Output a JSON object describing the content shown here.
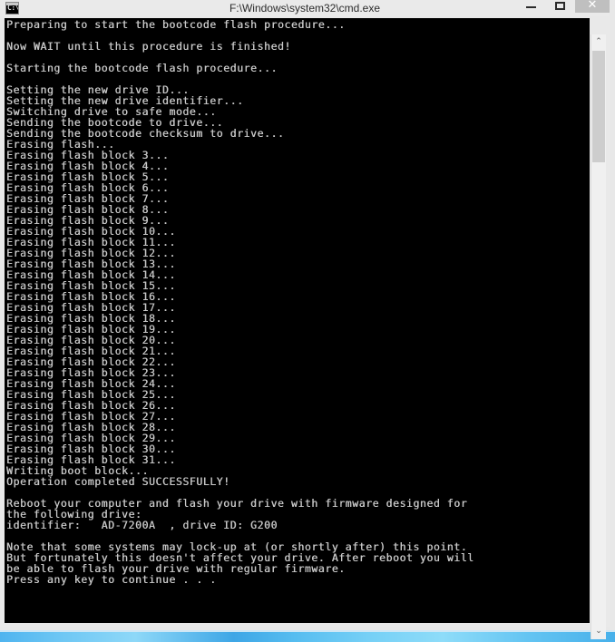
{
  "window": {
    "title": "F:\\Windows\\system32\\cmd.exe",
    "icon_name": "cmd-icon",
    "icon_glyph": "C:\\",
    "controls": {
      "minimize_label": "–",
      "maximize_label": "□",
      "close_label": "✕"
    }
  },
  "scrollbar": {
    "up_arrow": "⌃",
    "down_arrow": "⌄"
  },
  "console": {
    "foreground_color": "#c8c8c8",
    "background_color": "#000000",
    "output": "Preparing to start the bootcode flash procedure...\n\nNow WAIT until this procedure is finished!\n\nStarting the bootcode flash procedure...\n\nSetting the new drive ID...\nSetting the new drive identifier...\nSwitching drive to safe mode...\nSending the bootcode to drive...\nSending the bootcode checksum to drive...\nErasing flash...\nErasing flash block 3...\nErasing flash block 4...\nErasing flash block 5...\nErasing flash block 6...\nErasing flash block 7...\nErasing flash block 8...\nErasing flash block 9...\nErasing flash block 10...\nErasing flash block 11...\nErasing flash block 12...\nErasing flash block 13...\nErasing flash block 14...\nErasing flash block 15...\nErasing flash block 16...\nErasing flash block 17...\nErasing flash block 18...\nErasing flash block 19...\nErasing flash block 20...\nErasing flash block 21...\nErasing flash block 22...\nErasing flash block 23...\nErasing flash block 24...\nErasing flash block 25...\nErasing flash block 26...\nErasing flash block 27...\nErasing flash block 28...\nErasing flash block 29...\nErasing flash block 30...\nErasing flash block 31...\nWriting boot block...\nOperation completed SUCCESSFULLY!\n\nReboot your computer and flash your drive with firmware designed for\nthe following drive:\nidentifier:   AD-7200A  , drive ID: G200\n\nNote that some systems may lock-up at (or shortly after) this point.\nBut fortunately this doesn't affect your drive. After reboot you will\nbe able to flash your drive with regular firmware.\nPress any key to continue . . ."
  }
}
